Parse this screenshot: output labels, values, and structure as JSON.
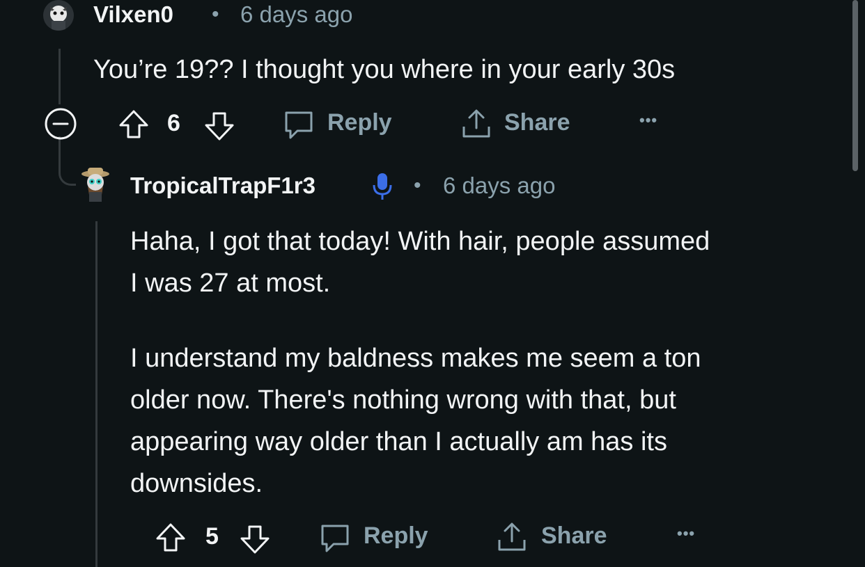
{
  "comment1": {
    "username": "Vilxen0",
    "separator": "•",
    "timestamp": "6 days ago",
    "text": "You’re 19?? I thought you where in your early 30s",
    "votes": "6",
    "reply_label": "Reply",
    "share_label": "Share",
    "more_label": "•••"
  },
  "comment2": {
    "username": "TropicalTrapF1r3",
    "separator": "•",
    "timestamp": "6 days ago",
    "paragraph1_line1": "Haha, I got that today! With hair, people assumed",
    "paragraph1_line2": "I was 27 at most.",
    "paragraph2_line1": "I understand my baldness makes me seem a ton",
    "paragraph2_line2": "older now. There's nothing wrong with that, but",
    "paragraph2_line3": "appearing way older than I actually am has its",
    "paragraph2_line4": "downsides.",
    "votes": "5",
    "reply_label": "Reply",
    "share_label": "Share",
    "more_label": "•••"
  },
  "colors": {
    "background": "#0e1416",
    "text": "#f2f4f5",
    "meta": "#8ba2ad",
    "mic_badge": "#3b6ee8"
  }
}
